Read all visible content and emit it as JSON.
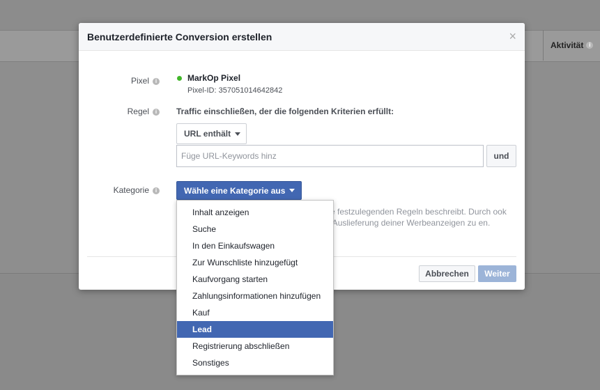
{
  "background": {
    "column_header": "Aktivität"
  },
  "dialog": {
    "title": "Benutzerdefinierte Conversion erstellen",
    "close_icon": "×",
    "pixel": {
      "label": "Pixel",
      "name": "MarkOp Pixel",
      "id_text": "Pixel-ID: 357051014642842",
      "status_color": "#42b72a"
    },
    "rule": {
      "label": "Regel",
      "description": "Traffic einschließen, der die folgenden Kriterien erfüllt:",
      "condition_dropdown": "URL enthält",
      "keyword_placeholder": "Füge URL-Keywords hinz",
      "and_button": "und"
    },
    "category": {
      "label": "Kategorie",
      "button": "Wähle eine Kategorie aus",
      "description": "eine festzulegenden Regeln beschreibt. Durch ook die Auslieferung deiner Werbeanzeigen zu en."
    },
    "cancel_button": "Abbrechen",
    "next_button": "Weiter",
    "accent_color": "#4267b2"
  },
  "category_menu": {
    "items": [
      "Inhalt anzeigen",
      "Suche",
      "In den Einkaufswagen",
      "Zur Wunschliste hinzugefügt",
      "Kaufvorgang starten",
      "Zahlungsinformationen hinzufügen",
      "Kauf",
      "Lead",
      "Registrierung abschließen",
      "Sonstiges"
    ],
    "selected": "Lead"
  }
}
